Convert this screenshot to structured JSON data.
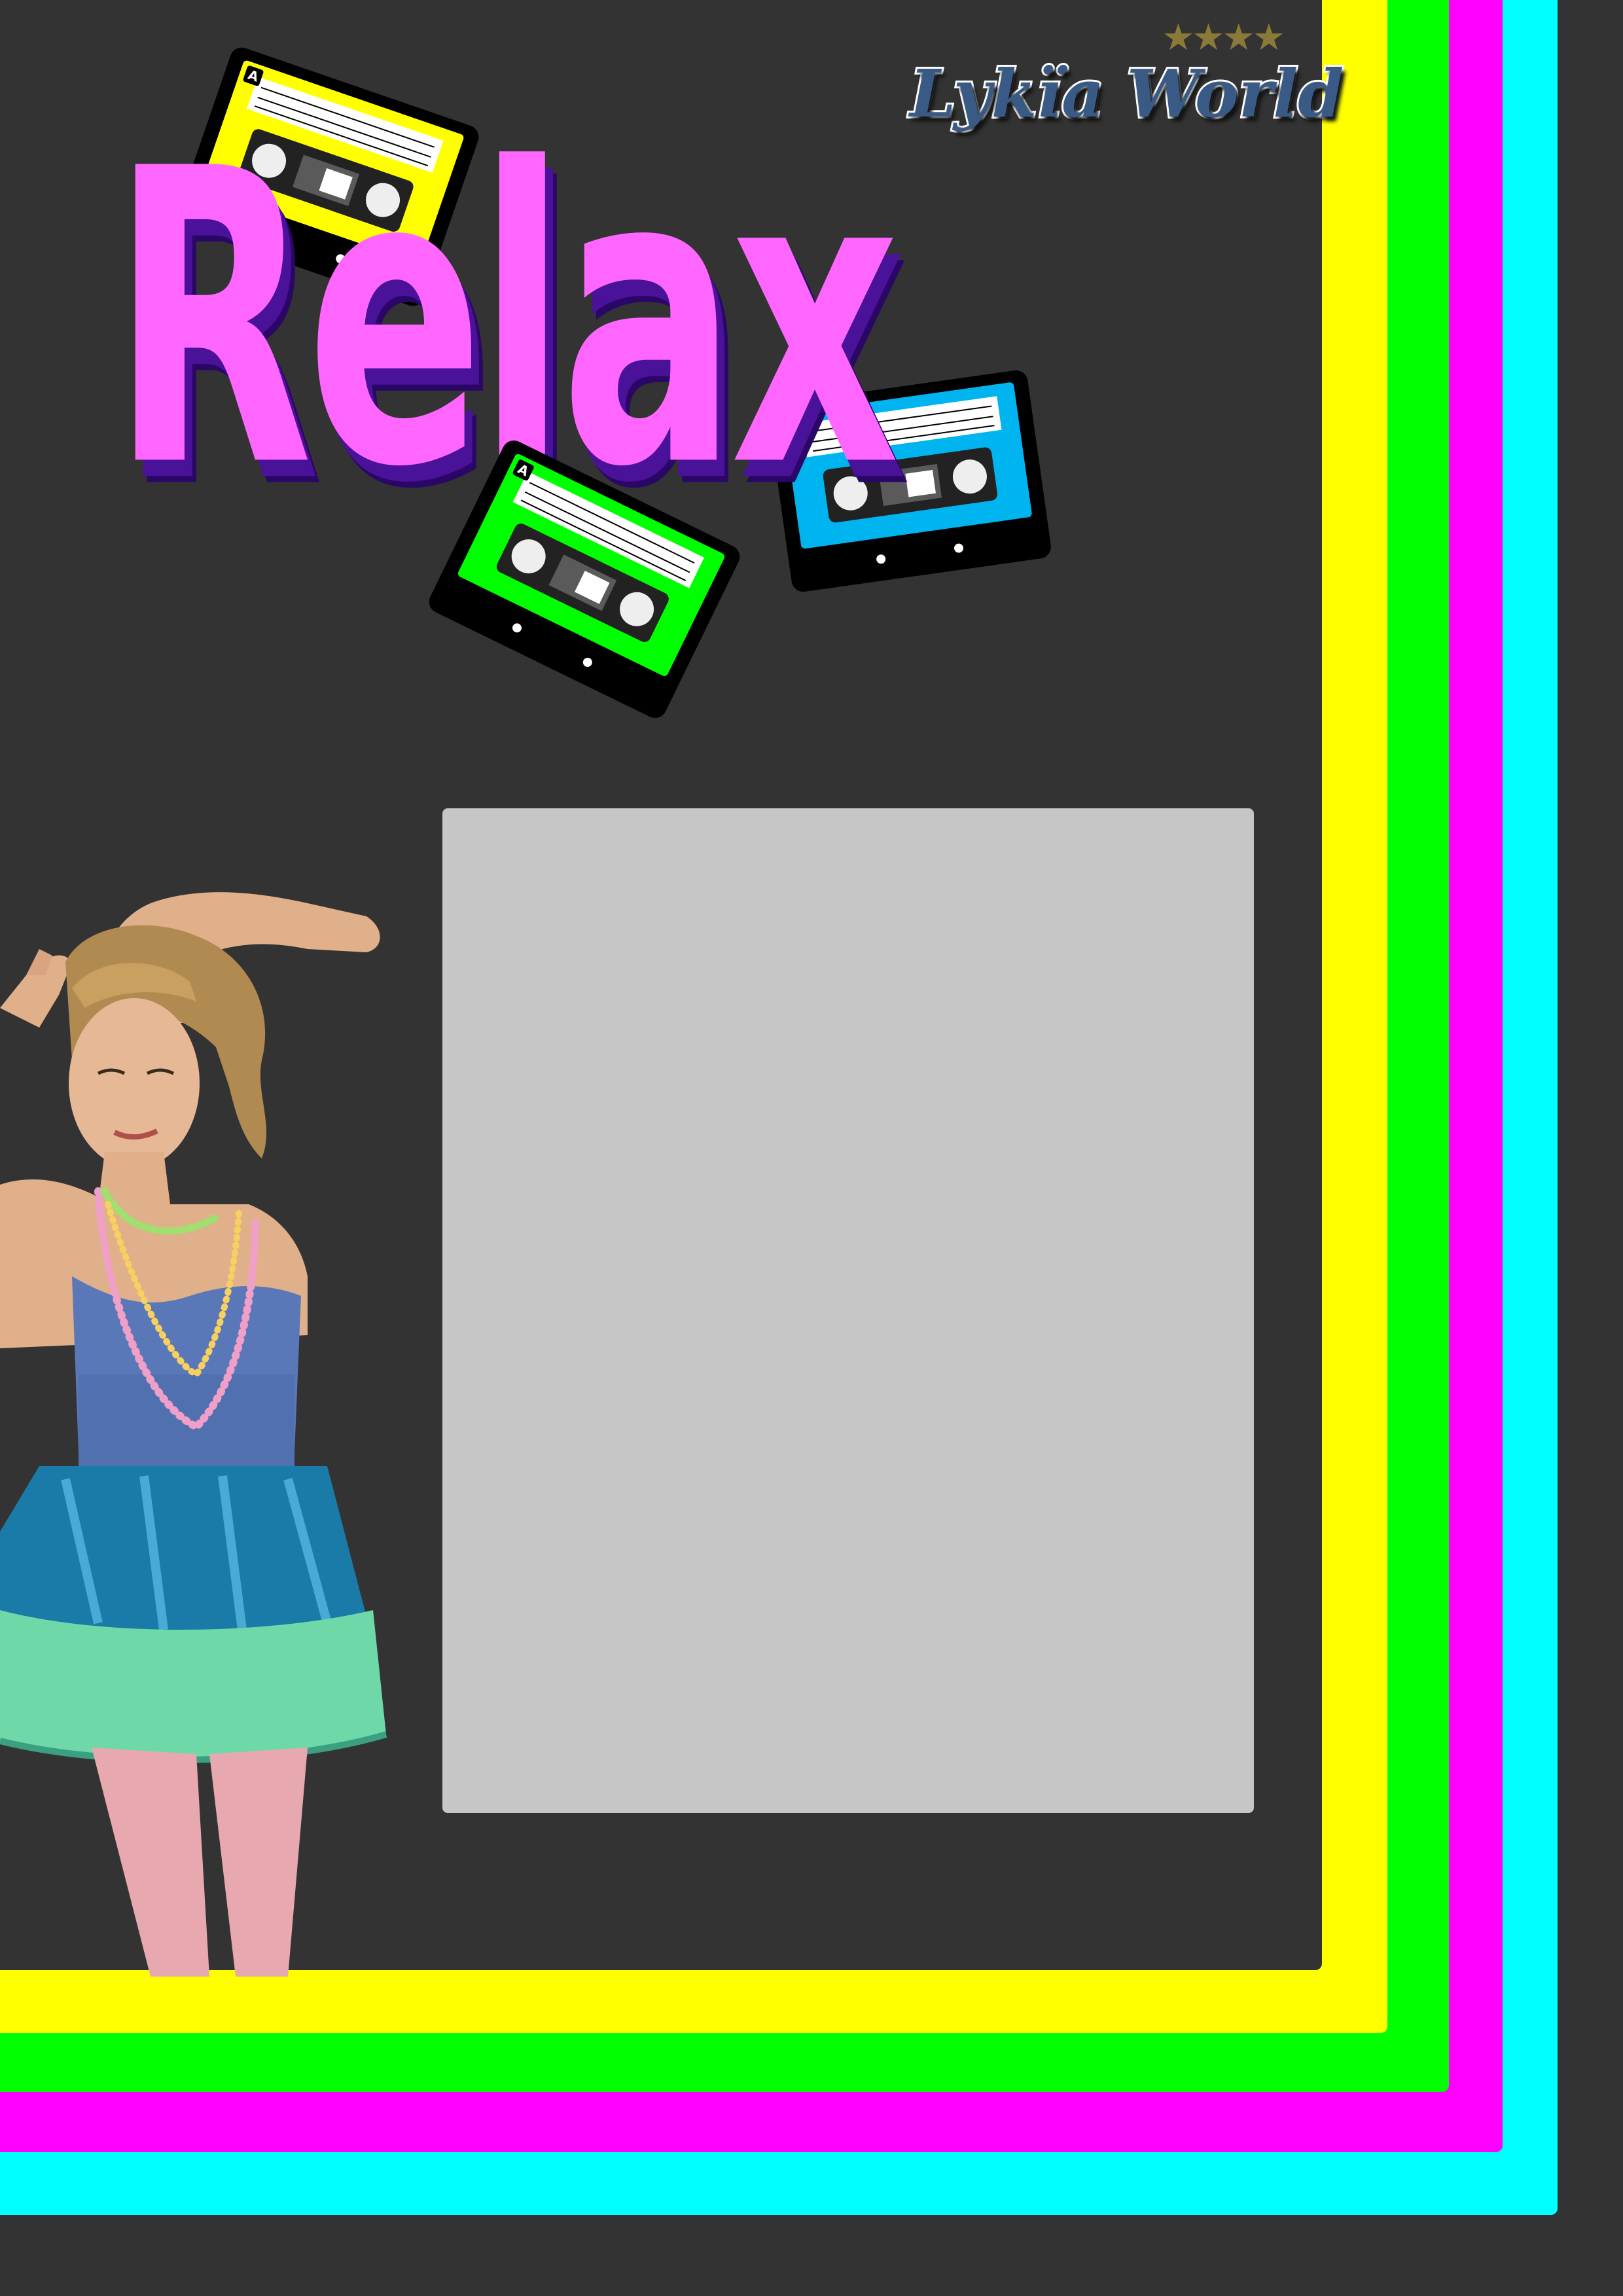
{
  "title": "Relax",
  "logo": {
    "text": "Lykïa World",
    "stars": "★★★★",
    "text_color": "#3a5a86",
    "star_color": "#8a7a3a"
  },
  "colors": {
    "background": "#333333",
    "band_cyan": "#00ffff",
    "band_magenta": "#ff00ff",
    "band_green": "#00ff00",
    "band_yellow": "#ffff00",
    "title": "#ff66ff",
    "title_shadow": "#4a1199",
    "photo_frame": "#c6c6c6"
  },
  "cassettes": [
    {
      "name": "yellow",
      "color": "#ffff00",
      "side_label": "A"
    },
    {
      "name": "green",
      "color": "#00ff00",
      "side_label": "A"
    },
    {
      "name": "blue",
      "color": "#00b4f0",
      "side_label": ""
    }
  ]
}
